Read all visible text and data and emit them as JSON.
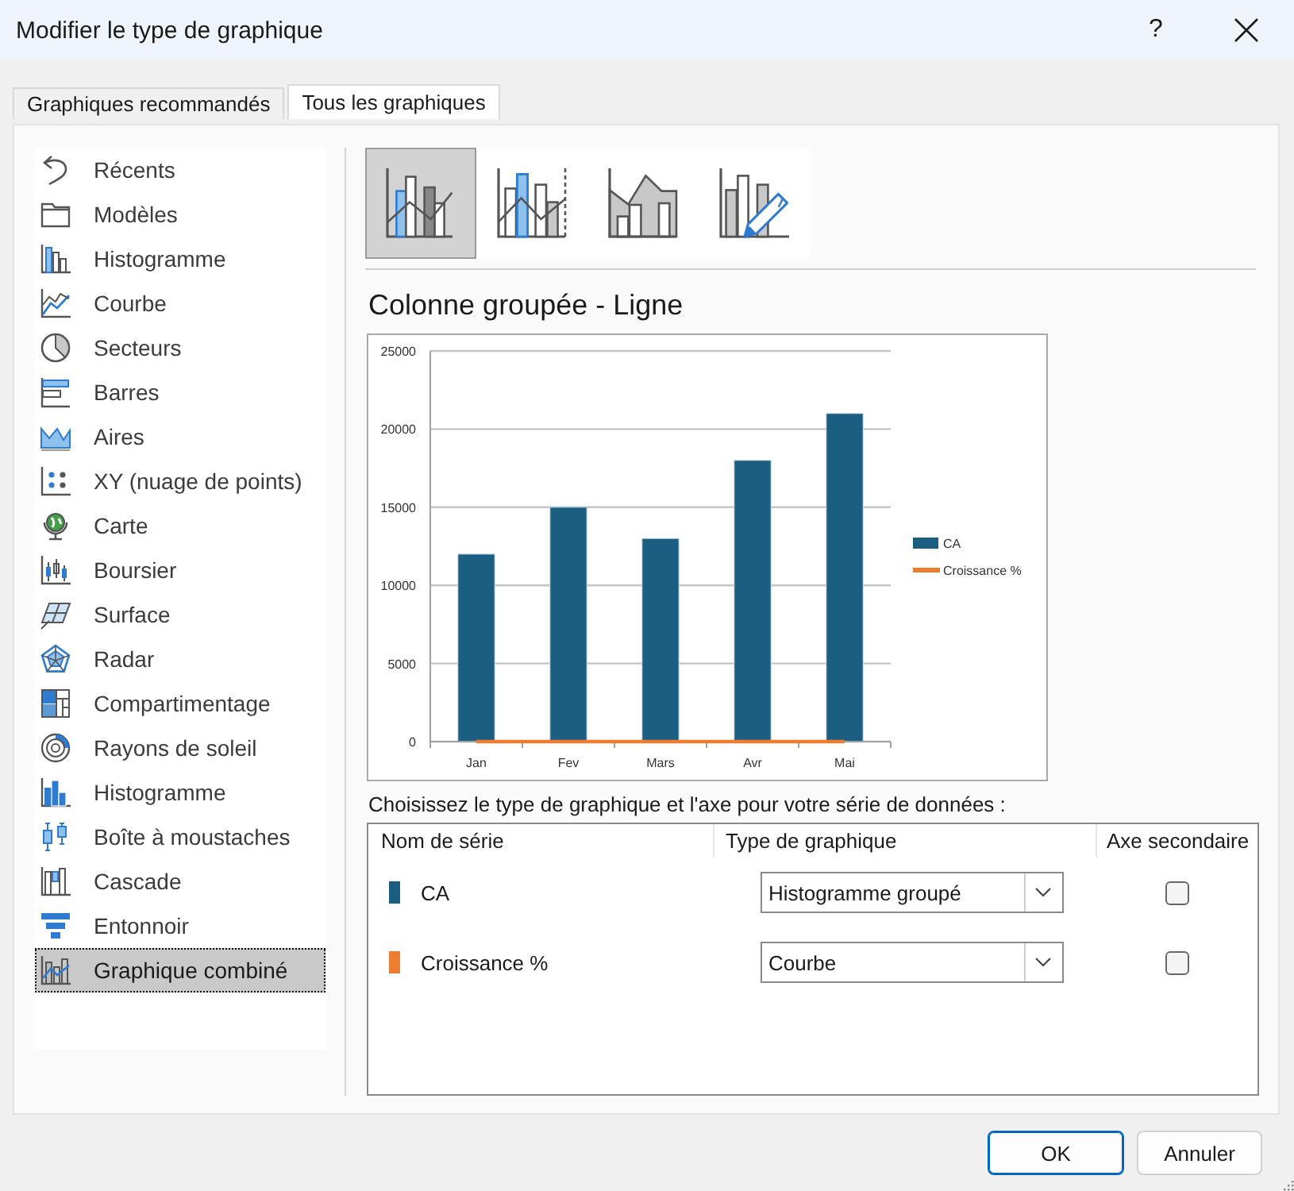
{
  "window": {
    "title": "Modifier le type de graphique",
    "help": "?"
  },
  "tabs": [
    {
      "label": "Graphiques recommandés",
      "selected": false
    },
    {
      "label": "Tous les graphiques",
      "selected": true
    }
  ],
  "chart_types": [
    {
      "label": "Récents",
      "selected": false
    },
    {
      "label": "Modèles",
      "selected": false
    },
    {
      "label": "Histogramme",
      "selected": false
    },
    {
      "label": "Courbe",
      "selected": false
    },
    {
      "label": "Secteurs",
      "selected": false
    },
    {
      "label": "Barres",
      "selected": false
    },
    {
      "label": "Aires",
      "selected": false
    },
    {
      "label": "XY (nuage de points)",
      "selected": false
    },
    {
      "label": "Carte",
      "selected": false
    },
    {
      "label": "Boursier",
      "selected": false
    },
    {
      "label": "Surface",
      "selected": false
    },
    {
      "label": "Radar",
      "selected": false
    },
    {
      "label": "Compartimentage",
      "selected": false
    },
    {
      "label": "Rayons de soleil",
      "selected": false
    },
    {
      "label": "Histogramme",
      "selected": false
    },
    {
      "label": "Boîte à moustaches",
      "selected": false
    },
    {
      "label": "Cascade",
      "selected": false
    },
    {
      "label": "Entonnoir",
      "selected": false
    },
    {
      "label": "Graphique combiné",
      "selected": true
    }
  ],
  "subtypes": [
    {
      "selected": true
    },
    {
      "selected": false
    },
    {
      "selected": false
    },
    {
      "selected": false
    }
  ],
  "preview": {
    "title": "Colonne groupée - Ligne",
    "chart_data": {
      "type": "bar",
      "categories": [
        "Jan",
        "Fev",
        "Mars",
        "Avr",
        "Mai"
      ],
      "series": [
        {
          "name": "CA",
          "color": "#1b5e82",
          "type": "bar",
          "values": [
            12000,
            15000,
            13000,
            18000,
            21000
          ]
        },
        {
          "name": "Croissance %",
          "color": "#ed7d31",
          "type": "line",
          "values": [
            0,
            0,
            0,
            0,
            0
          ]
        }
      ],
      "ylim": [
        0,
        25000
      ],
      "yticks": [
        0,
        5000,
        10000,
        15000,
        20000,
        25000
      ],
      "grid": true,
      "legend": "right"
    }
  },
  "series_table": {
    "caption": "Choisissez le type de graphique et l'axe pour votre série de données :",
    "columns": [
      "Nom de série",
      "Type de graphique",
      "Axe secondaire"
    ],
    "rows": [
      {
        "name": "CA",
        "color": "#1b5e82",
        "chart_type": "Histogramme groupé",
        "secondary_axis": false
      },
      {
        "name": "Croissance %",
        "color": "#ed7d31",
        "chart_type": "Courbe",
        "secondary_axis": false
      }
    ]
  },
  "buttons": [
    {
      "label": "OK",
      "kind": "primary"
    },
    {
      "label": "Annuler",
      "kind": "secondary"
    }
  ]
}
